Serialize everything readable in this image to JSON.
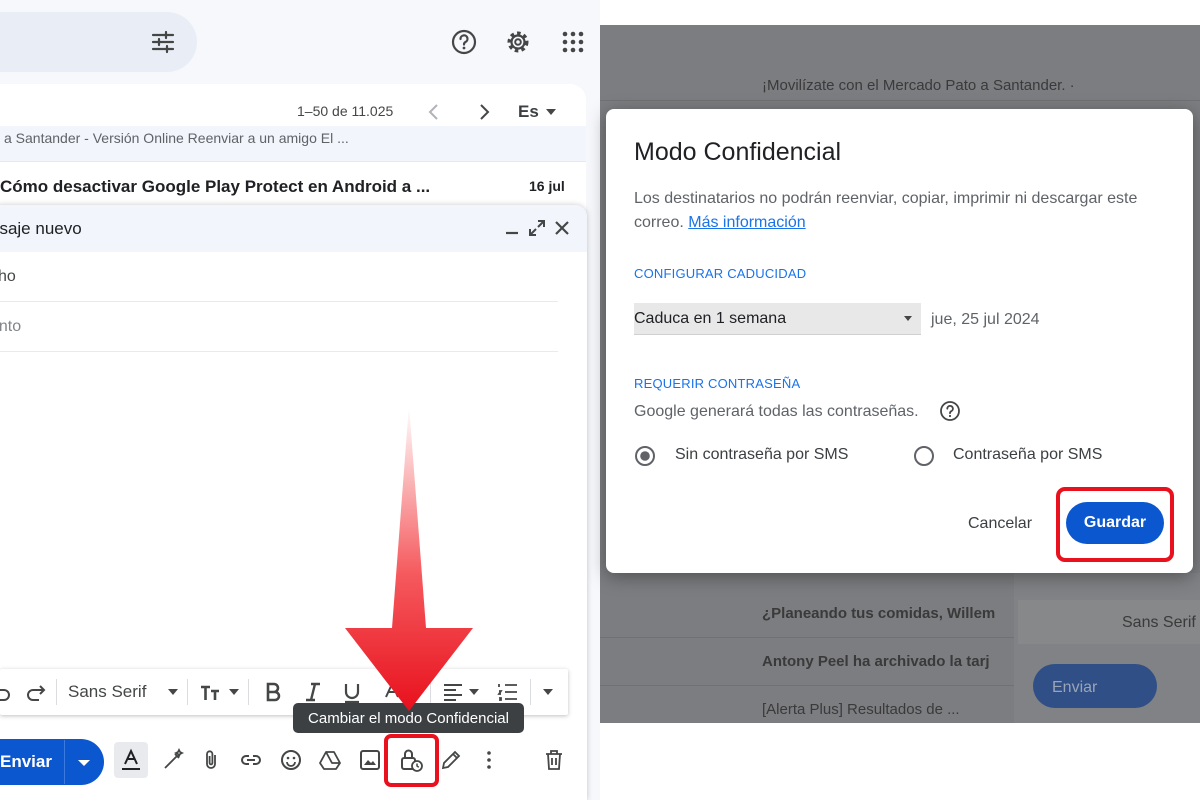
{
  "left_panel": {
    "pagination": {
      "range": "1–50 de 11.025",
      "language": "Es"
    },
    "mail_list": [
      {
        "snippet": "a Santander - Versión Online Reenviar a un amigo El ..."
      },
      {
        "subject": "Cómo desactivar Google Play Protect en Android a ...",
        "date": "16 jul"
      }
    ],
    "compose": {
      "title": "nsaje nuevo",
      "to_field": "cho",
      "subject_field": "unto",
      "format_bar": {
        "font": "Sans Serif"
      },
      "tooltip": "Cambiar el modo Confidencial",
      "send_label": "Enviar"
    },
    "icons": [
      "tune-icon",
      "help-icon",
      "settings-icon",
      "apps-icon",
      "chevron-left-icon",
      "chevron-right-icon",
      "minimize-icon",
      "expand-icon",
      "close-icon",
      "undo-icon",
      "redo-icon",
      "text-size-icon",
      "bold-icon",
      "italic-icon",
      "underline-icon",
      "text-color-icon",
      "align-icon",
      "list-icon",
      "more-format-icon",
      "formatting-icon",
      "ai-pen-icon",
      "attach-icon",
      "link-icon",
      "emoji-icon",
      "drive-icon",
      "image-icon",
      "confidential-lock-icon",
      "signature-icon",
      "more-icon",
      "trash-icon"
    ]
  },
  "right_panel": {
    "background_snippets": {
      "row1": "¡Movilízate con el Mercado Pato a Santander. ·",
      "row2": "¿Planeando tus comidas, Willem",
      "row3": "Antony Peel ha archivado la tarj",
      "row4": "[Alerta Plus] Resultados de ...",
      "font": "Sans Serif",
      "send": "Enviar"
    },
    "dialog": {
      "title": "Modo Confidencial",
      "description": "Los destinatarios no podrán reenviar, copiar, imprimir ni descargar este correo.",
      "link": "Más información",
      "expiry_section": "CONFIGURAR CADUCIDAD",
      "expiry_value": "Caduca en 1 semana",
      "expiry_date": "jue, 25 jul 2024",
      "password_section": "REQUERIR CONTRASEÑA",
      "password_note": "Google generará todas las contraseñas.",
      "options": [
        "Sin contraseña por SMS",
        "Contraseña por SMS"
      ],
      "selected_option": 0,
      "cancel_label": "Cancelar",
      "save_label": "Guardar"
    }
  },
  "colors": {
    "primary": "#0b57d0",
    "link": "#1a73e8",
    "highlight": "#e8111d",
    "tooltip": "#3c4043",
    "overlay": "#7b7d80"
  }
}
